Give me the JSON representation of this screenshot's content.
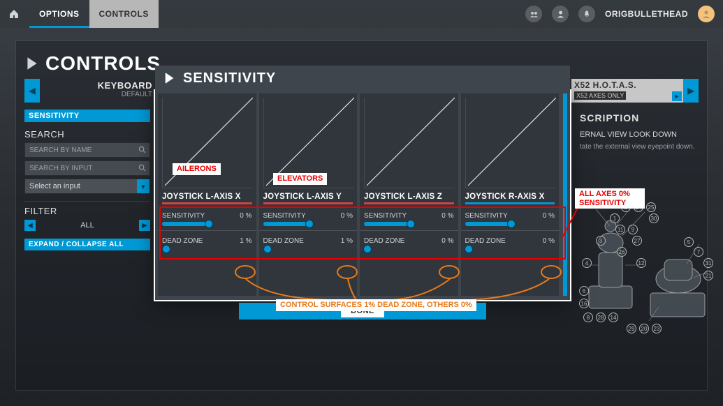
{
  "topbar": {
    "options_label": "OPTIONS",
    "controls_label": "CONTROLS",
    "username": "ORIGBULLETHEAD"
  },
  "page": {
    "title": "CONTROLS"
  },
  "devices": {
    "left": {
      "name": "KEYBOARD",
      "sub": "DEFAULT"
    },
    "right": {
      "name": "X52 H.O.T.A.S.",
      "sub": "X52 AXES ONLY"
    }
  },
  "leftpanel": {
    "sensitivity_label": "SENSITIVITY",
    "search_label": "SEARCH",
    "search_name_placeholder": "SEARCH BY NAME",
    "search_input_placeholder": "SEARCH BY INPUT",
    "select_placeholder": "Select an input",
    "filter_label": "FILTER",
    "filter_value": "ALL",
    "expand_label": "EXPAND / COLLAPSE ALL"
  },
  "description": {
    "header": "SCRIPTION",
    "title": "ERNAL VIEW LOOK DOWN",
    "body": "tate the external view eyepoint down."
  },
  "modal": {
    "title": "SENSITIVITY",
    "sensitivity_label": "SENSITIVITY",
    "deadzone_label": "DEAD ZONE",
    "done_label": "DONE",
    "axes": [
      {
        "name": "JOYSTICK L-AXIS X",
        "sensitivity": "0 %",
        "deadzone": "1 %"
      },
      {
        "name": "JOYSTICK L-AXIS Y",
        "sensitivity": "0 %",
        "deadzone": "1 %"
      },
      {
        "name": "JOYSTICK L-AXIS Z",
        "sensitivity": "0 %",
        "deadzone": "0 %"
      },
      {
        "name": "JOYSTICK R-AXIS X",
        "sensitivity": "0 %",
        "deadzone": "0 %"
      }
    ]
  },
  "annotations": {
    "ailerons": "AILERONS",
    "elevators": "ELEVATORS",
    "all_axes": "ALL AXES 0% SENSITIVITY",
    "dead_zone_note": "CONTROL SURFACES 1% DEAD ZONE, OTHERS 0%"
  }
}
